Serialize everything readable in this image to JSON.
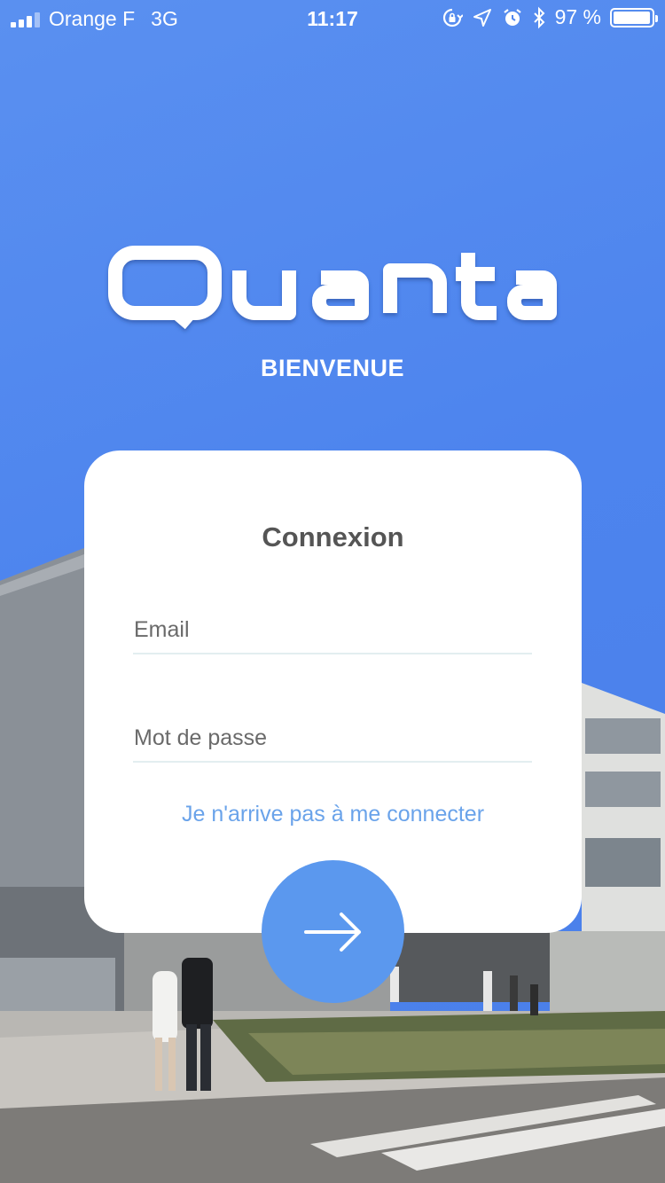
{
  "status_bar": {
    "carrier": "Orange F",
    "network": "3G",
    "time": "11:17",
    "battery_text": "97 %",
    "battery_level": 0.97,
    "icons": [
      "signal-icon",
      "rotation-lock-icon",
      "location-icon",
      "alarm-icon",
      "bluetooth-icon",
      "battery-icon"
    ]
  },
  "header": {
    "logo_text": "Quanta",
    "welcome": "BIENVENUE"
  },
  "login": {
    "title": "Connexion",
    "email_placeholder": "Email",
    "password_placeholder": "Mot de passe",
    "forgot_link": "Je n'arrive pas à me connecter",
    "submit_icon": "arrow-right-icon"
  },
  "colors": {
    "background": "#4f86ef",
    "card": "#ffffff",
    "accent": "#5b98ee",
    "link": "#6aa3ea",
    "title_text": "#555555"
  }
}
